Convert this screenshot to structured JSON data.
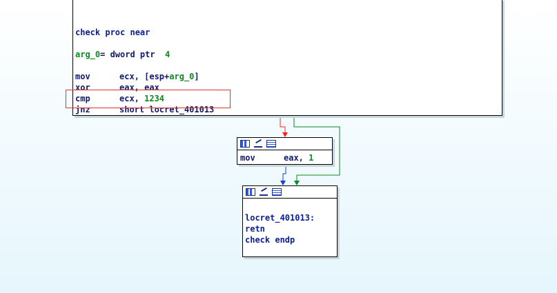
{
  "main_node": {
    "lines": [
      {
        "text": "",
        "type": "blank"
      },
      {
        "text": "",
        "type": "blank"
      },
      {
        "text": "check proc near",
        "type": "proc"
      },
      {
        "text": "",
        "type": "blank"
      },
      {
        "label": "arg_0",
        "rest": "= dword ptr  ",
        "num": "4",
        "type": "arg"
      },
      {
        "text": "",
        "type": "blank"
      },
      {
        "mn": "mov",
        "pre": "ecx, [esp+",
        "hl": "arg_0",
        "post": "]",
        "type": "ins_arg"
      },
      {
        "mn": "xor",
        "op": "eax, eax",
        "type": "ins"
      },
      {
        "mn": "cmp",
        "pre": "ecx, ",
        "num": "1234",
        "type": "ins_num"
      },
      {
        "mn": "jnz",
        "op": "short locret_401013",
        "type": "ins"
      }
    ]
  },
  "mid_node": {
    "toolbar_icons": [
      "graph-icon",
      "edit-icon",
      "list-icon"
    ],
    "mn": "mov",
    "pre": "eax, ",
    "num": "1"
  },
  "bottom_node": {
    "toolbar_icons": [
      "graph-icon",
      "edit-icon",
      "list-icon"
    ],
    "lines": [
      "",
      "locret_401013:",
      "retn",
      "check endp"
    ]
  },
  "colors": {
    "edge_taken": "#ff2020",
    "edge_fallthrough": "#1a3bd8",
    "edge_jump": "#0b8a1e",
    "highlight": "#e0302f"
  }
}
